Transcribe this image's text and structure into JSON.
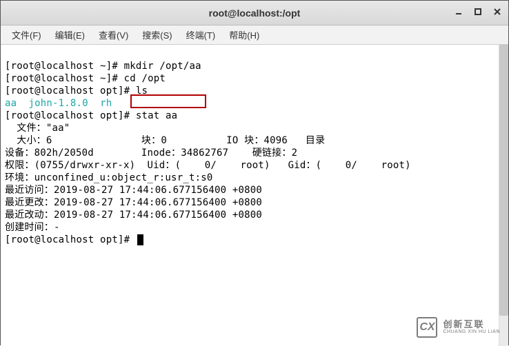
{
  "window": {
    "title": "root@localhost:/opt"
  },
  "menu": {
    "file": "文件(F)",
    "edit": "编辑(E)",
    "view": "查看(V)",
    "search": "搜索(S)",
    "terminal": "终端(T)",
    "help": "帮助(H)"
  },
  "term": {
    "l1_prompt": "[root@localhost ~]# ",
    "l1_cmd": "mkdir /opt/aa",
    "l2_prompt": "[root@localhost ~]# ",
    "l2_cmd": "cd /opt",
    "l3_prompt": "[root@localhost opt]# ",
    "l3_cmd": "ls",
    "ls_aa": "aa",
    "ls_john": "john-1.8.0",
    "ls_rh": "rh",
    "l5_prompt": "[root@localhost opt]# ",
    "l5_cmd": "stat aa",
    "out_file": "  文件：\"aa\"",
    "out_size": "  大小：6               块：0          IO 块：4096   目录",
    "out_device": "设备：802h/2050d        Inode：34862767    硬链接：2",
    "out_perm": "权限：(0755/drwxr-xr-x)  Uid：(    0/    root)   Gid：(    0/    root)",
    "out_env": "环境：unconfined_u:object_r:usr_t:s0",
    "out_access": "最近访问：2019-08-27 17:44:06.677156400 +0800",
    "out_modify": "最近更改：2019-08-27 17:44:06.677156400 +0800",
    "out_change": "最近改动：2019-08-27 17:44:06.677156400 +0800",
    "out_birth": "创建时间：-",
    "l_last_prompt": "[root@localhost opt]# "
  },
  "watermark": {
    "cn": "创新互联",
    "en": "CHUANG XIN HU LIAN"
  }
}
